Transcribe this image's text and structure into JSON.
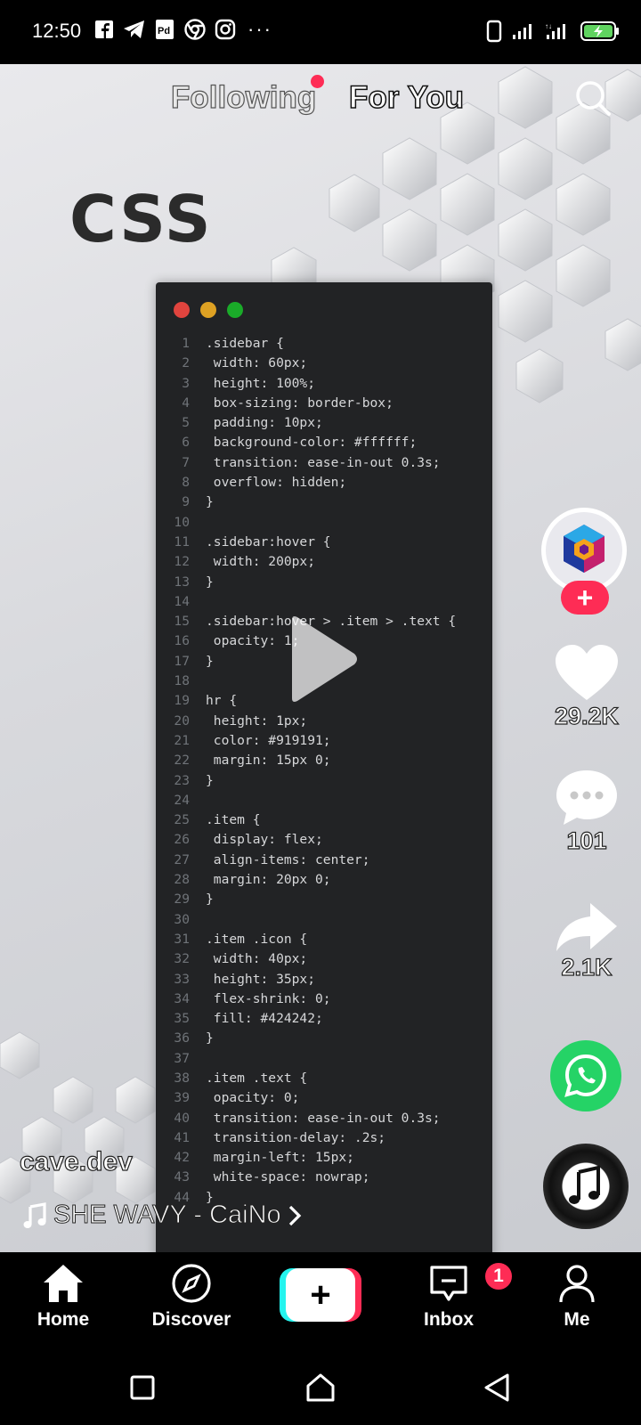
{
  "status_bar": {
    "time": "12:50",
    "left_icons": [
      "facebook-icon",
      "telegram-icon",
      "pdf-icon",
      "messenger-icon",
      "instagram-icon"
    ],
    "more": "···",
    "right_icons": [
      "vibrate-icon",
      "signal-icon",
      "signal-icon",
      "battery-charging-icon"
    ]
  },
  "top_nav": {
    "following_label": "Following",
    "for_you_label": "For You"
  },
  "video": {
    "overlay_title": "CSS",
    "code_lines": [
      {
        "n": "1",
        "t": ".sidebar {"
      },
      {
        "n": "2",
        "t": " width: 60px;"
      },
      {
        "n": "3",
        "t": " height: 100%;"
      },
      {
        "n": "4",
        "t": " box-sizing: border-box;"
      },
      {
        "n": "5",
        "t": " padding: 10px;"
      },
      {
        "n": "6",
        "t": " background-color: #ffffff;"
      },
      {
        "n": "7",
        "t": " transition: ease-in-out 0.3s;"
      },
      {
        "n": "8",
        "t": " overflow: hidden;"
      },
      {
        "n": "9",
        "t": "}"
      },
      {
        "n": "10",
        "t": ""
      },
      {
        "n": "11",
        "t": ".sidebar:hover {"
      },
      {
        "n": "12",
        "t": " width: 200px;"
      },
      {
        "n": "13",
        "t": "}"
      },
      {
        "n": "14",
        "t": ""
      },
      {
        "n": "15",
        "t": ".sidebar:hover > .item > .text {"
      },
      {
        "n": "16",
        "t": " opacity: 1;"
      },
      {
        "n": "17",
        "t": "}"
      },
      {
        "n": "18",
        "t": ""
      },
      {
        "n": "19",
        "t": "hr {"
      },
      {
        "n": "20",
        "t": " height: 1px;"
      },
      {
        "n": "21",
        "t": " color: #919191;"
      },
      {
        "n": "22",
        "t": " margin: 15px 0;"
      },
      {
        "n": "23",
        "t": "}"
      },
      {
        "n": "24",
        "t": ""
      },
      {
        "n": "25",
        "t": ".item {"
      },
      {
        "n": "26",
        "t": " display: flex;"
      },
      {
        "n": "27",
        "t": " align-items: center;"
      },
      {
        "n": "28",
        "t": " margin: 20px 0;"
      },
      {
        "n": "29",
        "t": "}"
      },
      {
        "n": "30",
        "t": ""
      },
      {
        "n": "31",
        "t": ".item .icon {"
      },
      {
        "n": "32",
        "t": " width: 40px;"
      },
      {
        "n": "33",
        "t": " height: 35px;"
      },
      {
        "n": "34",
        "t": " flex-shrink: 0;"
      },
      {
        "n": "35",
        "t": " fill: #424242;"
      },
      {
        "n": "36",
        "t": "}"
      },
      {
        "n": "37",
        "t": ""
      },
      {
        "n": "38",
        "t": ".item .text {"
      },
      {
        "n": "39",
        "t": " opacity: 0;"
      },
      {
        "n": "40",
        "t": " transition: ease-in-out 0.3s;"
      },
      {
        "n": "41",
        "t": " transition-delay: .2s;"
      },
      {
        "n": "42",
        "t": " margin-left: 15px;"
      },
      {
        "n": "43",
        "t": " white-space: nowrap;"
      },
      {
        "n": "44",
        "t": "}"
      }
    ]
  },
  "actions": {
    "likes": "29.2K",
    "comments": "101",
    "shares": "2.1K"
  },
  "caption": {
    "username": "cave.dev",
    "song": "SHE WAVY - CaiNo"
  },
  "bottom_nav": {
    "home": "Home",
    "discover": "Discover",
    "inbox": "Inbox",
    "inbox_badge": "1",
    "me": "Me"
  },
  "colors": {
    "accent": "#fe2c55",
    "cyan": "#25f4ee",
    "whatsapp": "#25d366"
  }
}
